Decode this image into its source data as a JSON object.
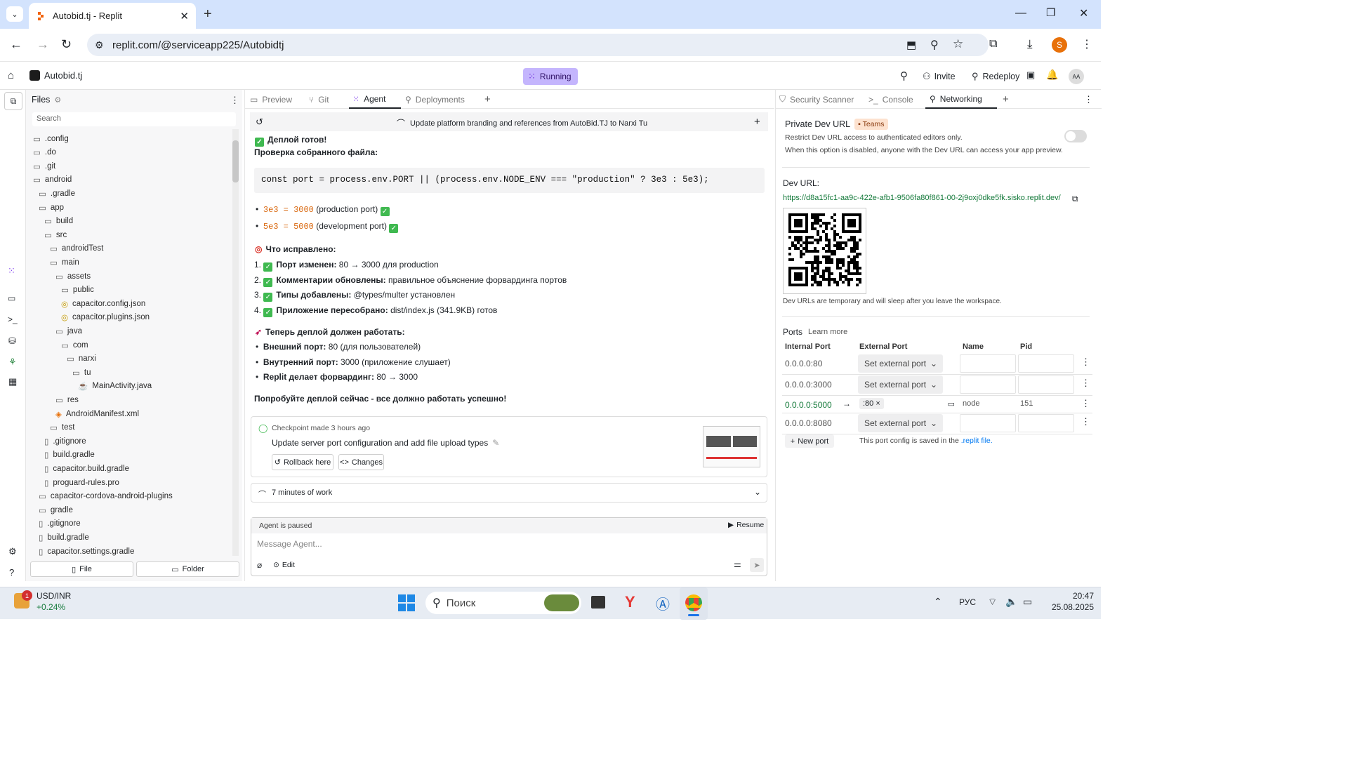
{
  "browser": {
    "tab_title": "Autobid.tj - Replit",
    "url": "replit.com/@serviceapp225/Autobidtj",
    "profile_initial": "S"
  },
  "app": {
    "project_name": "Autobid.tj",
    "status": "Running",
    "invite_label": "Invite",
    "redeploy_label": "Redeploy",
    "avatar": "AA"
  },
  "files": {
    "title": "Files",
    "search_placeholder": "Search",
    "items": [
      {
        "name": ".config",
        "depth": 0,
        "type": "folder"
      },
      {
        "name": ".do",
        "depth": 0,
        "type": "folder"
      },
      {
        "name": ".git",
        "depth": 0,
        "type": "folder"
      },
      {
        "name": "android",
        "depth": 0,
        "type": "folder-open"
      },
      {
        "name": ".gradle",
        "depth": 1,
        "type": "folder"
      },
      {
        "name": "app",
        "depth": 1,
        "type": "folder-open"
      },
      {
        "name": "build",
        "depth": 2,
        "type": "folder"
      },
      {
        "name": "src",
        "depth": 2,
        "type": "folder-open"
      },
      {
        "name": "androidTest",
        "depth": 3,
        "type": "folder"
      },
      {
        "name": "main",
        "depth": 3,
        "type": "folder-open"
      },
      {
        "name": "assets",
        "depth": 4,
        "type": "folder-open"
      },
      {
        "name": "public",
        "depth": 5,
        "type": "folder"
      },
      {
        "name": "capacitor.config.json",
        "depth": 5,
        "type": "json"
      },
      {
        "name": "capacitor.plugins.json",
        "depth": 5,
        "type": "json"
      },
      {
        "name": "java",
        "depth": 4,
        "type": "folder-open"
      },
      {
        "name": "com",
        "depth": 5,
        "type": "folder-open"
      },
      {
        "name": "narxi",
        "depth": 6,
        "type": "folder-open"
      },
      {
        "name": "tu",
        "depth": 7,
        "type": "folder-open"
      },
      {
        "name": "MainActivity.java",
        "depth": 8,
        "type": "java"
      },
      {
        "name": "res",
        "depth": 4,
        "type": "folder"
      },
      {
        "name": "AndroidManifest.xml",
        "depth": 4,
        "type": "xml"
      },
      {
        "name": "test",
        "depth": 3,
        "type": "folder"
      },
      {
        "name": ".gitignore",
        "depth": 2,
        "type": "file"
      },
      {
        "name": "build.gradle",
        "depth": 2,
        "type": "file"
      },
      {
        "name": "capacitor.build.gradle",
        "depth": 2,
        "type": "file"
      },
      {
        "name": "proguard-rules.pro",
        "depth": 2,
        "type": "file"
      },
      {
        "name": "capacitor-cordova-android-plugins",
        "depth": 1,
        "type": "folder"
      },
      {
        "name": "gradle",
        "depth": 1,
        "type": "folder"
      },
      {
        "name": ".gitignore",
        "depth": 1,
        "type": "file"
      },
      {
        "name": "build.gradle",
        "depth": 1,
        "type": "file"
      },
      {
        "name": "capacitor.settings.gradle",
        "depth": 1,
        "type": "file"
      }
    ],
    "new_file_label": "File",
    "new_folder_label": "Folder"
  },
  "center_tabs": [
    "Preview",
    "Git",
    "Agent",
    "Deployments"
  ],
  "agent": {
    "thread_title": "Update platform branding and references from AutoBid.TJ to Narxi Tu",
    "deploy_ready": "Деплой готов!",
    "check_heading": "Проверка собранного файла:",
    "code_line": "const port = process.env.PORT || (process.env.NODE_ENV === \"production\" ? 3e3 : 5e3);",
    "bullets1": [
      {
        "code": "3e3 = 3000",
        "text": " (production port)"
      },
      {
        "code": "5e3 = 5000",
        "text": " (development port)"
      }
    ],
    "fixed_heading": "Что исправлено:",
    "fixed_items": [
      {
        "num": "1.",
        "bold": "Порт изменен:",
        "text": " 80 → 3000 для production"
      },
      {
        "num": "2.",
        "bold": "Комментарии обновлены:",
        "text": " правильное объяснение форвардинга портов"
      },
      {
        "num": "3.",
        "bold": "Типы добавлены:",
        "text": " @types/multer установлен"
      },
      {
        "num": "4.",
        "bold": "Приложение пересобрано:",
        "text": " dist/index.js (341.9KB) готов"
      }
    ],
    "now_heading": "Теперь деплой должен работать:",
    "now_items": [
      {
        "bold": "Внешний порт:",
        "text": " 80 (для пользователей)"
      },
      {
        "bold": "Внутренний порт:",
        "text": " 3000 (приложение слушает)"
      },
      {
        "bold": "Replit делает форвардинг:",
        "text": " 80 → 3000"
      }
    ],
    "try_now": "Попробуйте деплой сейчас - все должно работать успешно!",
    "checkpoint_meta": "Checkpoint made 3 hours ago",
    "checkpoint_title": "Update server port configuration and add file upload types",
    "rollback_label": "Rollback here",
    "changes_label": "Changes",
    "work_summary": "7 minutes of work",
    "paused_label": "Agent is paused",
    "resume_label": "Resume",
    "message_placeholder": "Message Agent...",
    "edit_label": "Edit"
  },
  "right_tabs": [
    "Security Scanner",
    "Console",
    "Networking"
  ],
  "networking": {
    "private_title": "Private Dev URL",
    "teams_badge": "Teams",
    "private_desc1": "Restrict Dev URL access to authenticated editors only.",
    "private_desc2": "When this option is disabled, anyone with the Dev URL can access your app preview.",
    "dev_url_label": "Dev URL:",
    "dev_url": "https://d8a15fc1-aa9c-422e-afb1-9506fa80f861-00-2j9oxj0dke5fk.sisko.replit.dev/",
    "dev_note": "Dev URLs are temporary and will sleep after you leave the workspace.",
    "ports_title": "Ports",
    "learn_more": "Learn more",
    "headers": [
      "Internal Port",
      "External Port",
      "Name",
      "Pid"
    ],
    "rows": [
      {
        "internal": "0.0.0.0:80",
        "external": "Set external port",
        "name": "",
        "pid": "",
        "active": false
      },
      {
        "internal": "0.0.0.0:3000",
        "external": "Set external port",
        "name": "",
        "pid": "",
        "active": false
      },
      {
        "internal": "0.0.0.0:5000",
        "external": ":80",
        "name": "node",
        "pid": "151",
        "active": true
      },
      {
        "internal": "0.0.0.0:8080",
        "external": "Set external port",
        "name": "",
        "pid": "",
        "active": false
      }
    ],
    "new_port_label": "New port",
    "config_note": "This port config is saved in the",
    "config_file": ".replit file."
  },
  "taskbar": {
    "ticker": "USD/INR",
    "change": "+0.24%",
    "badge": "1",
    "search": "Поиск",
    "lang": "РУС",
    "time": "20:47",
    "date": "25.08.2025"
  },
  "colors": {
    "accent": "#0079f2",
    "running": "#c4b5fd",
    "green": "#157a3b",
    "check": "#3fb950"
  }
}
